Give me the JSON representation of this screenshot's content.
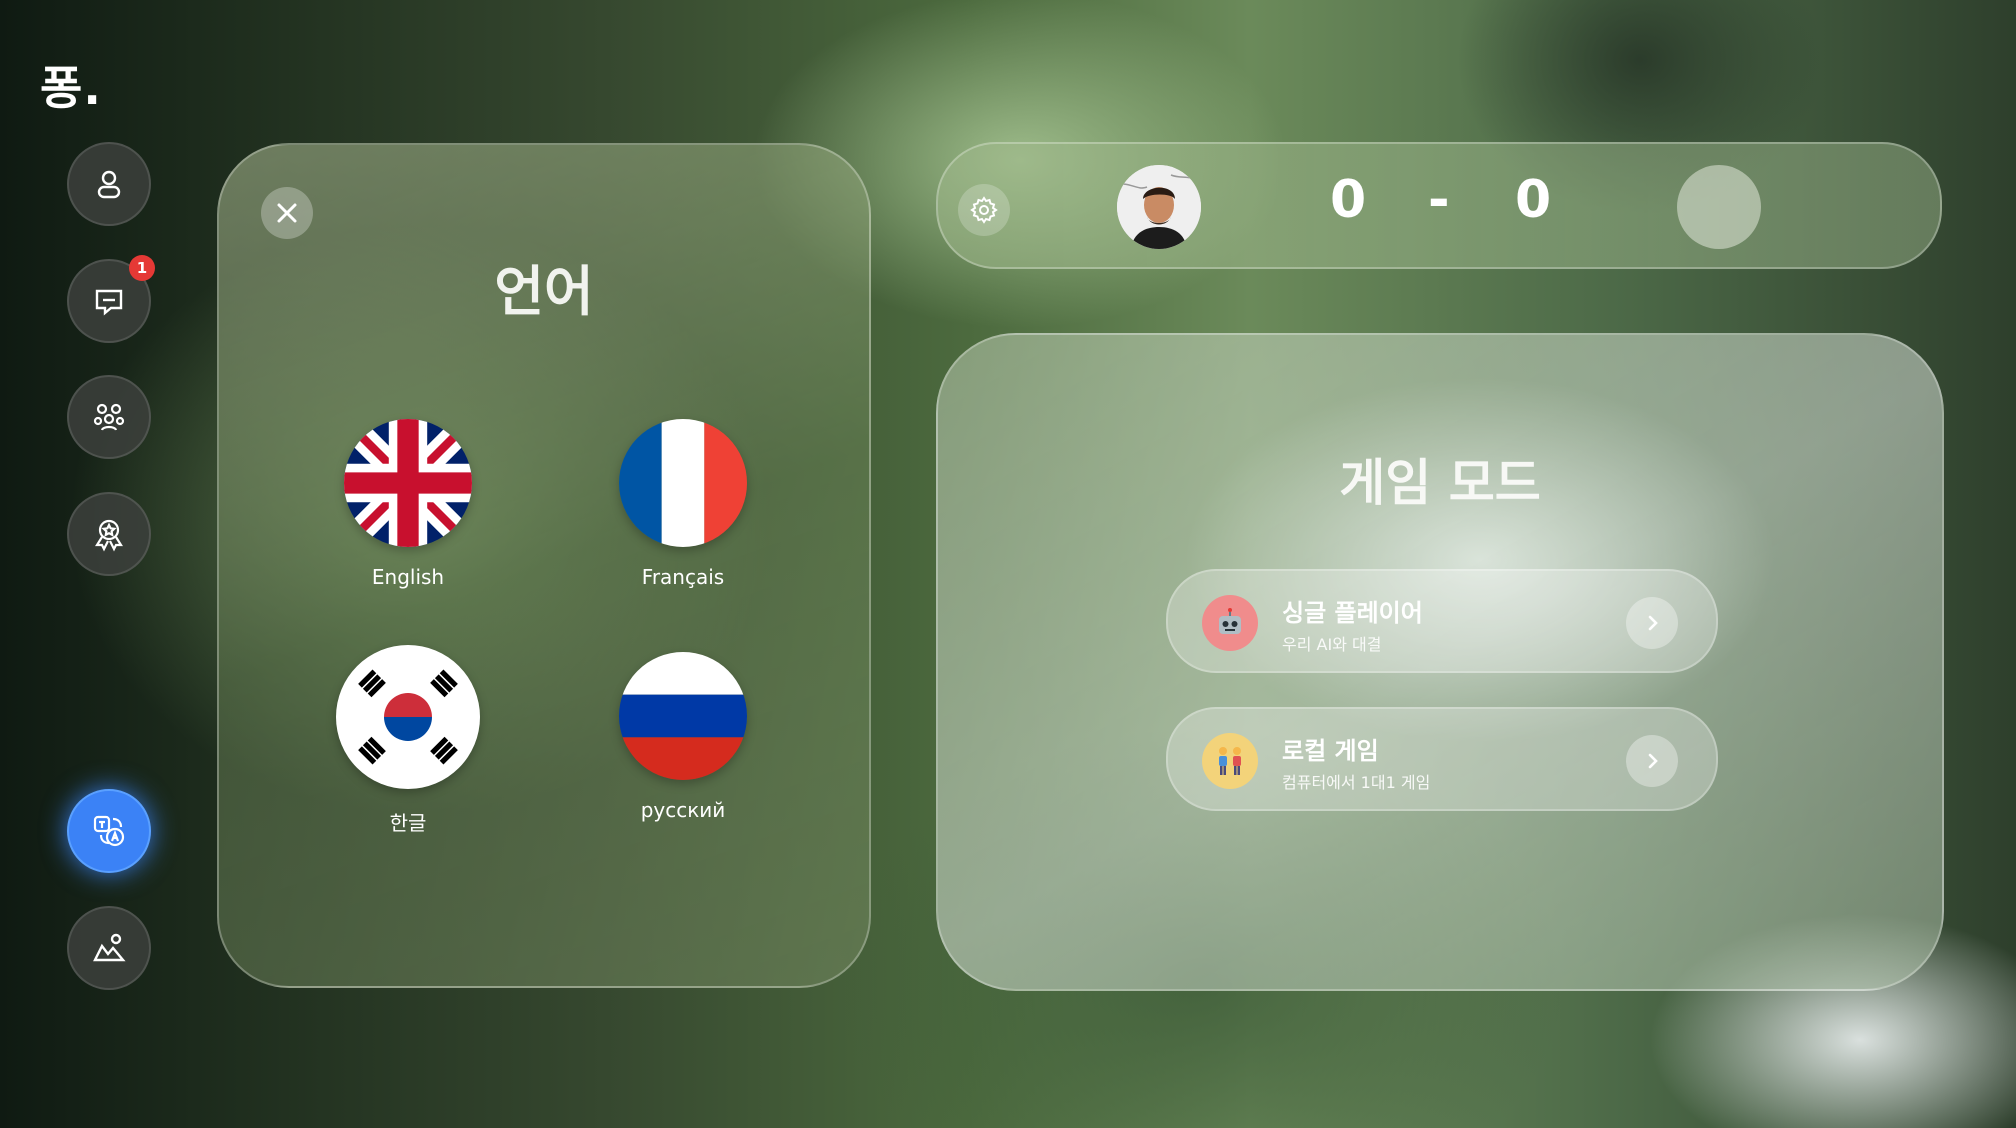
{
  "app": {
    "logo": "퐁."
  },
  "sidebar": {
    "items": [
      {
        "icon": "user-icon"
      },
      {
        "icon": "chat-icon",
        "badge": "1"
      },
      {
        "icon": "friends-icon"
      },
      {
        "icon": "award-icon"
      },
      {
        "icon": "translate-icon",
        "active": true
      },
      {
        "icon": "landscape-icon"
      }
    ]
  },
  "language_panel": {
    "title": "언어",
    "languages": [
      {
        "label": "English",
        "flag": "uk"
      },
      {
        "label": "Français",
        "flag": "france"
      },
      {
        "label": "한글",
        "flag": "korea"
      },
      {
        "label": "русский",
        "flag": "russia"
      }
    ]
  },
  "scoreboard": {
    "score_left": "0",
    "separator": "-",
    "score_right": "0"
  },
  "game_mode": {
    "title": "게임 모드",
    "modes": [
      {
        "name": "싱글 플레이어",
        "desc": "우리 AI와 대결",
        "icon": "robot-icon"
      },
      {
        "name": "로컬 게임",
        "desc": "컴퓨터에서 1대1 게임",
        "icon": "two-players-icon"
      }
    ]
  },
  "colors": {
    "accent": "#3b82f6",
    "badge": "#e53935"
  }
}
